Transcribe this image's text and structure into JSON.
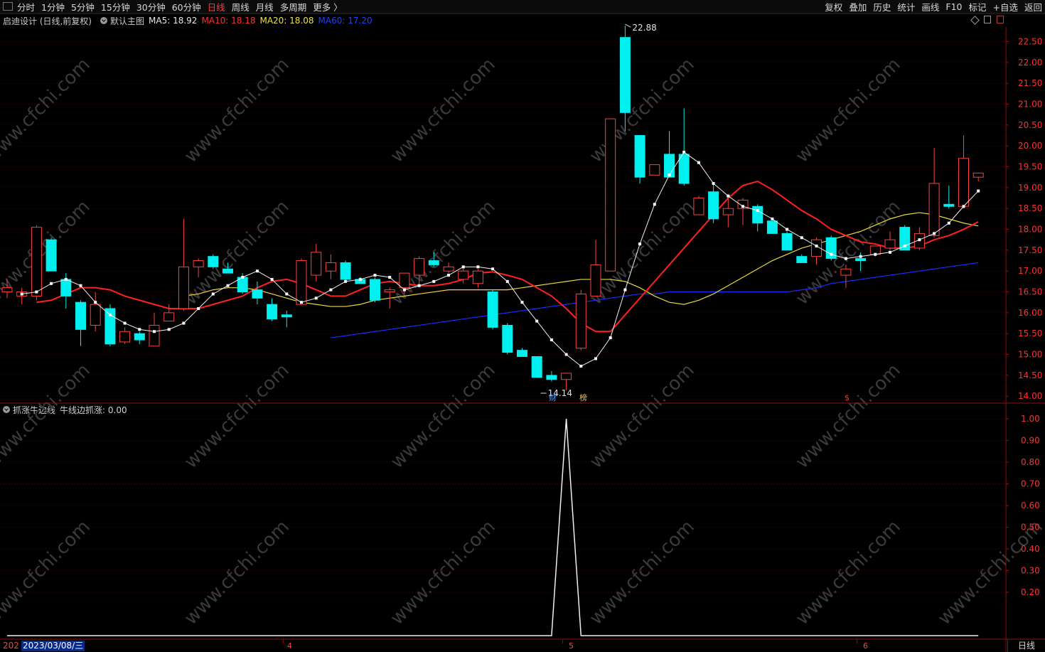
{
  "toolbar": {
    "periods": [
      "分时",
      "1分钟",
      "5分钟",
      "15分钟",
      "30分钟",
      "60分钟",
      "日线",
      "周线",
      "月线",
      "多周期",
      "更多 〉"
    ],
    "active_period": "日线",
    "tools": [
      "复权",
      "叠加",
      "历史",
      "统计",
      "画线",
      "F10",
      "标记",
      "+自选",
      "返回"
    ]
  },
  "main_panel": {
    "title": "启迪设计 (日线,前复权)",
    "indicator_name": "默认主图",
    "ma": [
      {
        "label": "MA5: 18.92",
        "color": "#e8e8e8"
      },
      {
        "label": "MA10: 18.18",
        "color": "#ff3030"
      },
      {
        "label": "MA20: 18.08",
        "color": "#f0e040"
      },
      {
        "label": "MA60: 17.20",
        "color": "#2040ff"
      }
    ],
    "high_label": "22.88",
    "low_label": "14.14",
    "y_ticks": [
      "22.50",
      "22.00",
      "21.50",
      "21.00",
      "20.50",
      "20.00",
      "19.50",
      "19.00",
      "18.50",
      "18.00",
      "17.50",
      "17.00",
      "16.50",
      "16.00",
      "15.50",
      "15.00",
      "14.50",
      "14.00"
    ],
    "event_badges": [
      {
        "text": "财",
        "color": "#4aa0ff"
      },
      {
        "text": "榜",
        "color": "#f0c040"
      },
      {
        "text": "$",
        "color": "#ff3030"
      }
    ]
  },
  "sub_panel": {
    "title": "抓涨牛边线",
    "value_label": "牛线边抓涨: 0.00",
    "y_ticks": [
      "1.00",
      "0.90",
      "0.80",
      "0.70",
      "0.60",
      "0.50",
      "0.40",
      "0.30",
      "0.20"
    ]
  },
  "footer": {
    "date_prefix": "202",
    "cursor_date": "2023/03/08/三",
    "months": [
      "4",
      "5",
      "6"
    ],
    "period_label": "日线"
  },
  "watermark": "www.cfchi.com",
  "chart_data": {
    "type": "candlestick",
    "ylim": [
      13.85,
      22.85
    ],
    "candles": [
      {
        "o": 16.5,
        "h": 16.8,
        "l": 16.35,
        "c": 16.6
      },
      {
        "o": 16.4,
        "h": 16.6,
        "l": 16.2,
        "c": 16.5
      },
      {
        "o": 16.4,
        "h": 18.1,
        "l": 16.3,
        "c": 18.05
      },
      {
        "o": 17.75,
        "h": 17.8,
        "l": 17.0,
        "c": 17.0
      },
      {
        "o": 16.8,
        "h": 16.95,
        "l": 16.1,
        "c": 16.4
      },
      {
        "o": 16.25,
        "h": 16.3,
        "l": 15.2,
        "c": 15.6
      },
      {
        "o": 15.7,
        "h": 16.5,
        "l": 15.55,
        "c": 16.2
      },
      {
        "o": 16.1,
        "h": 16.2,
        "l": 15.2,
        "c": 15.25
      },
      {
        "o": 15.3,
        "h": 15.65,
        "l": 15.25,
        "c": 15.55
      },
      {
        "o": 15.5,
        "h": 15.55,
        "l": 15.25,
        "c": 15.35
      },
      {
        "o": 15.2,
        "h": 16.0,
        "l": 15.2,
        "c": 15.7
      },
      {
        "o": 15.8,
        "h": 16.2,
        "l": 15.8,
        "c": 16.0
      },
      {
        "o": 16.1,
        "h": 18.25,
        "l": 16.05,
        "c": 17.1
      },
      {
        "o": 17.1,
        "h": 17.3,
        "l": 16.85,
        "c": 17.25
      },
      {
        "o": 17.35,
        "h": 17.4,
        "l": 17.05,
        "c": 17.1
      },
      {
        "o": 17.05,
        "h": 17.2,
        "l": 16.95,
        "c": 16.95
      },
      {
        "o": 16.85,
        "h": 16.95,
        "l": 16.45,
        "c": 16.5
      },
      {
        "o": 16.55,
        "h": 16.75,
        "l": 16.2,
        "c": 16.35
      },
      {
        "o": 16.2,
        "h": 16.35,
        "l": 15.8,
        "c": 15.85
      },
      {
        "o": 15.95,
        "h": 16.05,
        "l": 15.65,
        "c": 15.9
      },
      {
        "o": 16.2,
        "h": 17.3,
        "l": 16.2,
        "c": 17.25
      },
      {
        "o": 16.9,
        "h": 17.65,
        "l": 16.75,
        "c": 17.45
      },
      {
        "o": 17.0,
        "h": 17.4,
        "l": 16.8,
        "c": 17.2
      },
      {
        "o": 17.2,
        "h": 17.25,
        "l": 16.75,
        "c": 16.8
      },
      {
        "o": 16.8,
        "h": 16.85,
        "l": 16.7,
        "c": 16.7
      },
      {
        "o": 16.8,
        "h": 16.85,
        "l": 16.25,
        "c": 16.3
      },
      {
        "o": 16.5,
        "h": 16.6,
        "l": 16.1,
        "c": 16.55
      },
      {
        "o": 16.6,
        "h": 16.95,
        "l": 16.45,
        "c": 16.95
      },
      {
        "o": 16.9,
        "h": 17.35,
        "l": 16.65,
        "c": 17.3
      },
      {
        "o": 17.25,
        "h": 17.45,
        "l": 17.1,
        "c": 17.15
      },
      {
        "o": 17.0,
        "h": 17.2,
        "l": 16.95,
        "c": 17.1
      },
      {
        "o": 16.8,
        "h": 17.1,
        "l": 16.7,
        "c": 17.0
      },
      {
        "o": 16.7,
        "h": 17.05,
        "l": 16.6,
        "c": 17.0
      },
      {
        "o": 16.5,
        "h": 16.55,
        "l": 15.6,
        "c": 15.65
      },
      {
        "o": 15.7,
        "h": 15.75,
        "l": 15.0,
        "c": 15.05
      },
      {
        "o": 15.1,
        "h": 15.15,
        "l": 14.95,
        "c": 14.95
      },
      {
        "o": 14.95,
        "h": 14.95,
        "l": 14.45,
        "c": 14.45
      },
      {
        "o": 14.5,
        "h": 14.6,
        "l": 14.35,
        "c": 14.4
      },
      {
        "o": 14.4,
        "h": 14.55,
        "l": 14.14,
        "c": 14.55
      },
      {
        "o": 15.15,
        "h": 16.55,
        "l": 15.1,
        "c": 16.45
      },
      {
        "o": 16.4,
        "h": 17.75,
        "l": 16.4,
        "c": 17.15
      },
      {
        "o": 17.0,
        "h": 20.65,
        "l": 17.0,
        "c": 20.65
      },
      {
        "o": 22.6,
        "h": 22.88,
        "l": 20.35,
        "c": 20.8
      },
      {
        "o": 20.25,
        "h": 20.25,
        "l": 19.1,
        "c": 19.25
      },
      {
        "o": 19.3,
        "h": 19.55,
        "l": 19.3,
        "c": 19.55
      },
      {
        "o": 19.8,
        "h": 20.35,
        "l": 19.25,
        "c": 19.25
      },
      {
        "o": 19.8,
        "h": 20.9,
        "l": 19.05,
        "c": 19.1
      },
      {
        "o": 18.35,
        "h": 18.8,
        "l": 18.35,
        "c": 18.75
      },
      {
        "o": 18.9,
        "h": 19.1,
        "l": 18.15,
        "c": 18.25
      },
      {
        "o": 18.35,
        "h": 18.75,
        "l": 18.05,
        "c": 18.5
      },
      {
        "o": 18.5,
        "h": 18.75,
        "l": 18.1,
        "c": 18.7
      },
      {
        "o": 18.55,
        "h": 18.6,
        "l": 17.95,
        "c": 18.15
      },
      {
        "o": 18.2,
        "h": 18.2,
        "l": 17.9,
        "c": 17.9
      },
      {
        "o": 17.9,
        "h": 17.95,
        "l": 17.5,
        "c": 17.5
      },
      {
        "o": 17.35,
        "h": 17.4,
        "l": 17.2,
        "c": 17.2
      },
      {
        "o": 17.35,
        "h": 17.8,
        "l": 17.15,
        "c": 17.75
      },
      {
        "o": 17.8,
        "h": 17.85,
        "l": 17.25,
        "c": 17.3
      },
      {
        "o": 16.9,
        "h": 17.15,
        "l": 16.6,
        "c": 17.05
      },
      {
        "o": 17.3,
        "h": 17.45,
        "l": 17.0,
        "c": 17.25
      },
      {
        "o": 17.4,
        "h": 17.6,
        "l": 17.35,
        "c": 17.6
      },
      {
        "o": 17.55,
        "h": 17.95,
        "l": 17.5,
        "c": 17.75
      },
      {
        "o": 18.05,
        "h": 18.1,
        "l": 17.5,
        "c": 17.5
      },
      {
        "o": 17.55,
        "h": 18.05,
        "l": 17.5,
        "c": 17.9
      },
      {
        "o": 17.85,
        "h": 19.95,
        "l": 17.8,
        "c": 19.1
      },
      {
        "o": 18.6,
        "h": 19.05,
        "l": 18.5,
        "c": 18.55
      },
      {
        "o": 18.55,
        "h": 20.25,
        "l": 18.5,
        "c": 19.7
      },
      {
        "o": 19.25,
        "h": 19.35,
        "l": 19.15,
        "c": 19.35
      }
    ],
    "ma5": [
      16.45,
      16.5,
      16.7,
      16.8,
      16.65,
      16.25,
      15.95,
      15.75,
      15.6,
      15.55,
      15.6,
      15.75,
      16.1,
      16.45,
      16.65,
      16.85,
      17.0,
      16.8,
      16.45,
      16.25,
      16.35,
      16.55,
      16.75,
      16.8,
      16.9,
      16.85,
      16.55,
      16.65,
      16.75,
      16.9,
      17.1,
      17.1,
      17.05,
      16.75,
      16.25,
      15.8,
      15.35,
      15.0,
      14.72,
      14.9,
      15.4,
      16.55,
      17.65,
      18.6,
      19.3,
      19.85,
      19.6,
      19.1,
      18.8,
      18.55,
      18.45,
      18.25,
      18.0,
      17.8,
      17.6,
      17.4,
      17.3,
      17.35,
      17.4,
      17.45,
      17.6,
      17.75,
      17.9,
      18.15,
      18.55,
      18.92
    ],
    "ma10": [
      16.25,
      16.3,
      16.45,
      16.6,
      16.6,
      16.55,
      16.4,
      16.3,
      16.2,
      16.1,
      16.1,
      16.1,
      16.2,
      16.3,
      16.4,
      16.6,
      16.75,
      16.8,
      16.7,
      16.55,
      16.4,
      16.4,
      16.55,
      16.7,
      16.75,
      16.7,
      16.65,
      16.65,
      16.7,
      16.8,
      16.95,
      16.98,
      16.9,
      16.8,
      16.6,
      16.4,
      16.1,
      15.75,
      15.55,
      15.55,
      15.95,
      16.35,
      16.75,
      17.15,
      17.55,
      17.95,
      18.35,
      18.75,
      19.05,
      19.15,
      18.95,
      18.7,
      18.45,
      18.25,
      18.0,
      17.85,
      17.7,
      17.65,
      17.55,
      17.55,
      17.6,
      17.75,
      17.85,
      18.0,
      18.18
    ],
    "ma20": [
      16.4,
      16.45,
      16.55,
      16.6,
      16.6,
      16.55,
      16.45,
      16.35,
      16.25,
      16.2,
      16.15,
      16.15,
      16.2,
      16.3,
      16.35,
      16.4,
      16.45,
      16.5,
      16.55,
      16.55,
      16.55,
      16.55,
      16.55,
      16.6,
      16.65,
      16.7,
      16.75,
      16.8,
      16.8,
      16.8,
      16.75,
      16.6,
      16.4,
      16.25,
      16.2,
      16.3,
      16.45,
      16.65,
      16.85,
      17.05,
      17.25,
      17.4,
      17.55,
      17.65,
      17.75,
      17.85,
      17.95,
      18.1,
      18.25,
      18.35,
      18.4,
      18.35,
      18.25,
      18.15,
      18.08
    ],
    "ma60": [
      15.4,
      15.45,
      15.5,
      15.55,
      15.6,
      15.65,
      15.7,
      15.75,
      15.8,
      15.85,
      15.9,
      15.95,
      16.0,
      16.05,
      16.1,
      16.15,
      16.2,
      16.25,
      16.3,
      16.35,
      16.4,
      16.45,
      16.45,
      16.5,
      16.5,
      16.5,
      16.5,
      16.5,
      16.5,
      16.5,
      16.5,
      16.5,
      16.55,
      16.6,
      16.7,
      16.75,
      16.8,
      16.85,
      16.9,
      16.95,
      17.0,
      17.05,
      17.1,
      17.15,
      17.2
    ],
    "sub_signal": {
      "peak_index": 38,
      "peak_value": 1.0,
      "baseline": 0.0
    }
  }
}
